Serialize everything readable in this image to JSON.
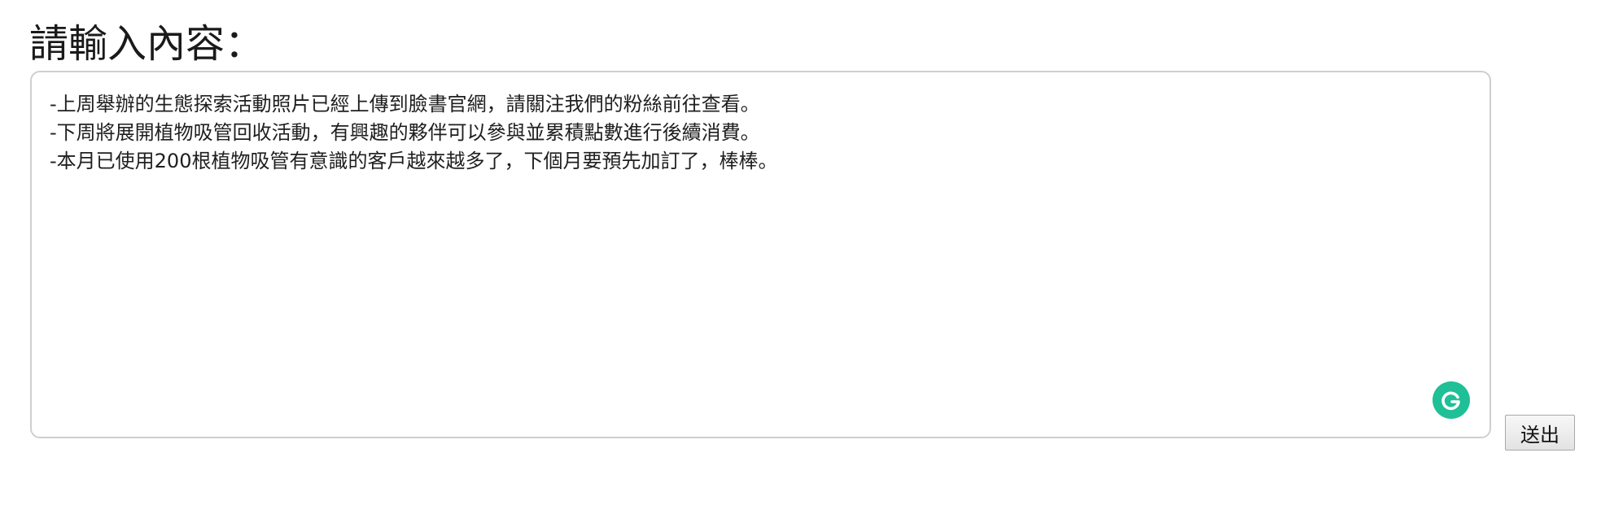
{
  "form": {
    "title": "請輸入內容：",
    "content_lines": [
      "-上周舉辦的生態探索活動照片已經上傳到臉書官網，請關注我們的粉絲前往查看。",
      "-下周將展開植物吸管回收活動，有興趣的夥伴可以參與並累積點數進行後續消費。",
      "-本月已使用200根植物吸管有意識的客戶越來越多了，下個月要預先加訂了，棒棒。"
    ],
    "submit_label": "送出"
  },
  "grammarly": {
    "icon": "grammarly-icon",
    "color": "#1fbf97"
  }
}
